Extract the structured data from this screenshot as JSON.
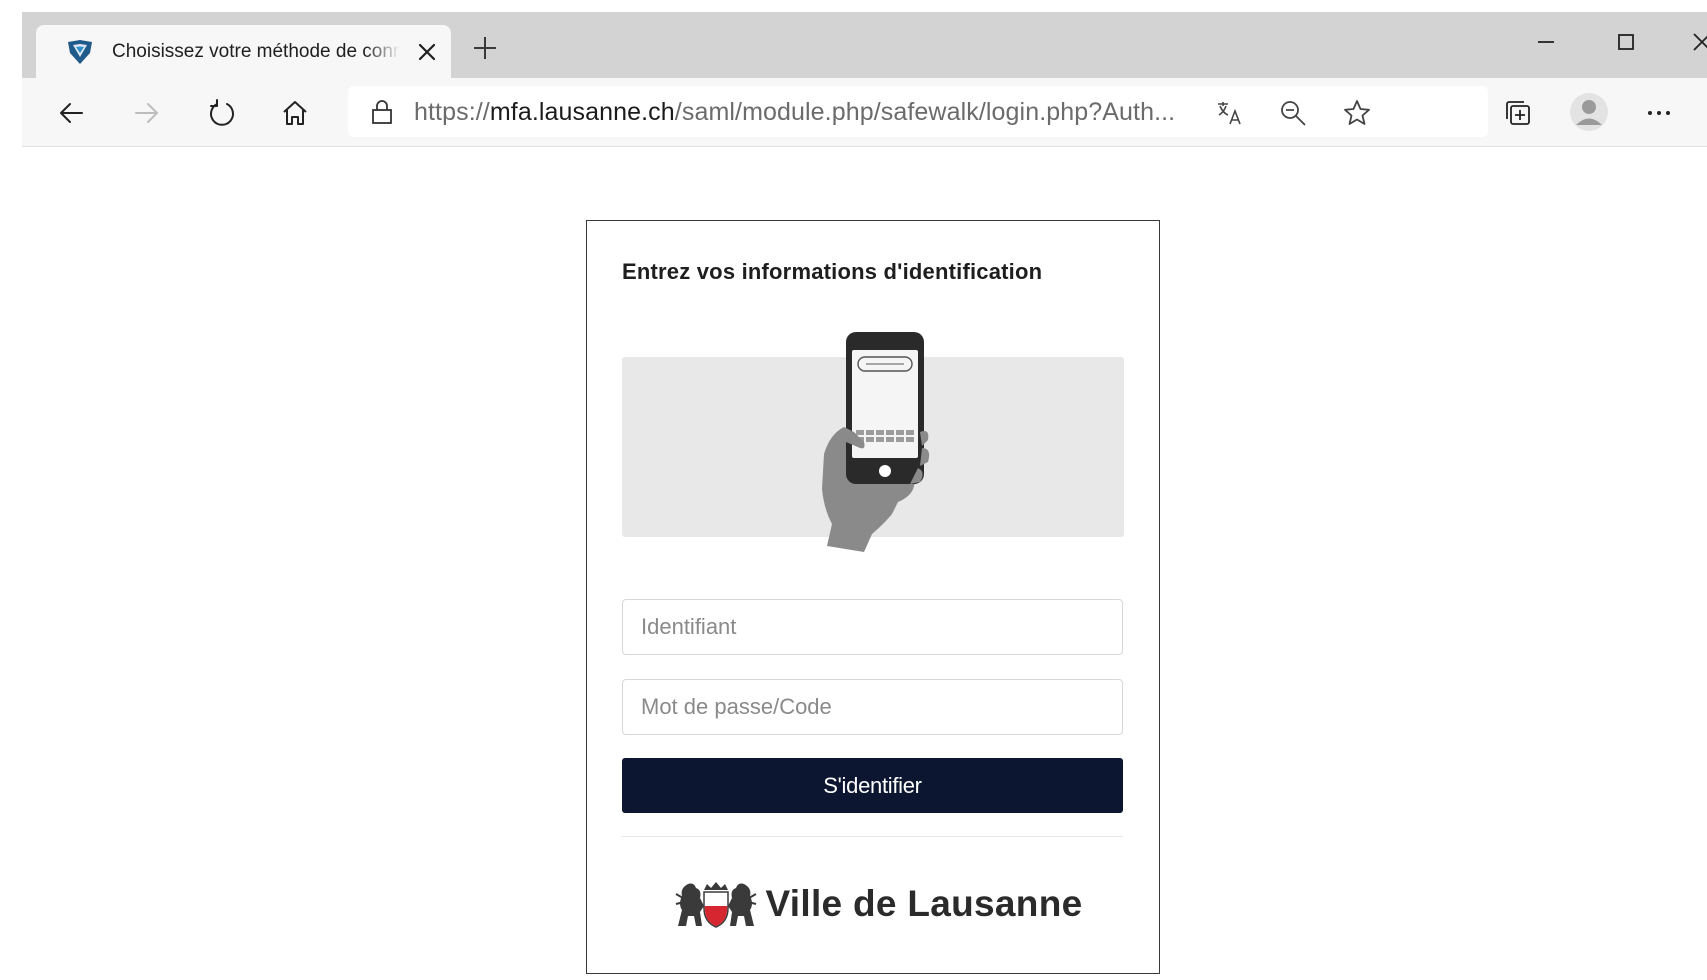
{
  "browser": {
    "tab": {
      "title": "Choisissez votre méthode de connexion",
      "favicon": "shield-logo-icon"
    },
    "toolbar": {
      "icons": [
        "back-arrow-icon",
        "forward-arrow-icon",
        "reload-icon",
        "home-icon",
        "lock-icon",
        "translate-icon",
        "zoom-icon",
        "favorite-star-icon",
        "collections-icon",
        "profile-avatar-icon",
        "more-options-icon"
      ]
    },
    "url": {
      "scheme": "https://",
      "host": "mfa.lausanne.ch",
      "path": "/saml/module.php/safewalk/login.php?Auth..."
    },
    "window_controls": [
      "minimize-icon",
      "maximize-icon",
      "close-window-icon"
    ]
  },
  "login": {
    "title": "Entrez vos informations d'identification",
    "illustration": "phone-in-hand-icon",
    "username_placeholder": "Identifiant",
    "password_placeholder": "Mot de passe/Code",
    "submit_label": "S'identifier"
  },
  "footer": {
    "brand_name": "Ville de Lausanne",
    "logo": "lausanne-crest-logo"
  },
  "colors": {
    "button_bg": "#0d1631",
    "tabstrip_bg": "#d3d3d3",
    "toolbar_bg": "#f7f7f7",
    "illustration_bg": "#e8e8e8",
    "crest_red": "#d62630"
  }
}
